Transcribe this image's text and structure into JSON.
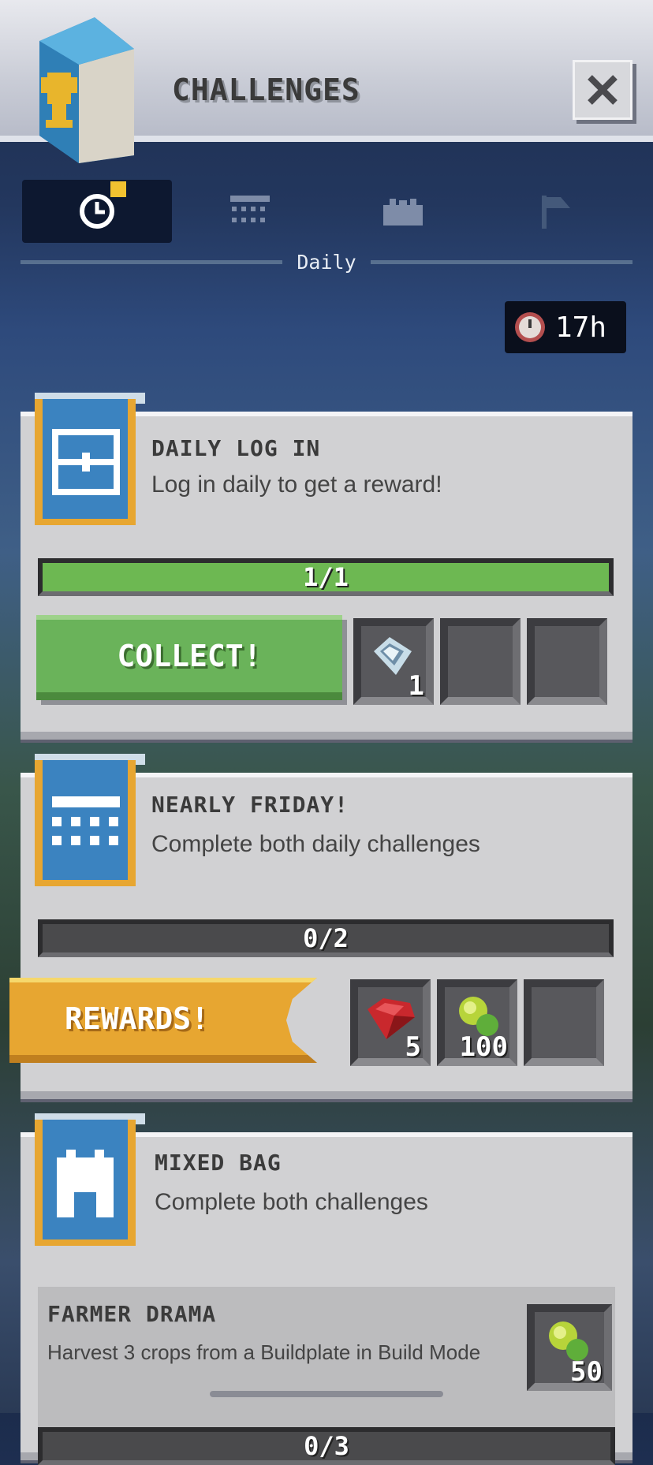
{
  "header": {
    "title": "CHALLENGES",
    "close_label": "close"
  },
  "tabs": [
    {
      "name": "daily",
      "icon": "clock-icon",
      "active": true,
      "badge": true
    },
    {
      "name": "weekly",
      "icon": "calendar-icon",
      "active": false
    },
    {
      "name": "season",
      "icon": "castle-icon",
      "active": false
    },
    {
      "name": "flag",
      "icon": "flag-icon",
      "active": false
    }
  ],
  "active_tab_label": "Daily",
  "timer": {
    "text": "17h"
  },
  "cards": [
    {
      "title": "DAILY LOG IN",
      "description": "Log in daily to get a reward!",
      "progress": "1/1",
      "progress_fraction": 1.0,
      "button": "COLLECT!",
      "rewards": [
        {
          "icon": "diamond-icon",
          "count": "1"
        },
        {
          "icon": "",
          "count": ""
        },
        {
          "icon": "",
          "count": ""
        }
      ]
    },
    {
      "title": "NEARLY FRIDAY!",
      "description": "Complete both daily challenges",
      "progress": "0/2",
      "progress_fraction": 0.0,
      "button": "REWARDS!",
      "rewards": [
        {
          "icon": "ruby-icon",
          "count": "5"
        },
        {
          "icon": "experience-orb-icon",
          "count": "100"
        },
        {
          "icon": "",
          "count": ""
        }
      ]
    },
    {
      "title": "MIXED BAG",
      "description": "Complete both challenges",
      "sub": {
        "title": "FARMER DRAMA",
        "description": "Harvest 3 crops from a Buildplate in Build Mode",
        "reward_count": "50",
        "progress": "0/3"
      }
    }
  ],
  "colors": {
    "accent_green": "#6db852",
    "accent_gold": "#e7a631",
    "navy": "#1c2c4c"
  }
}
